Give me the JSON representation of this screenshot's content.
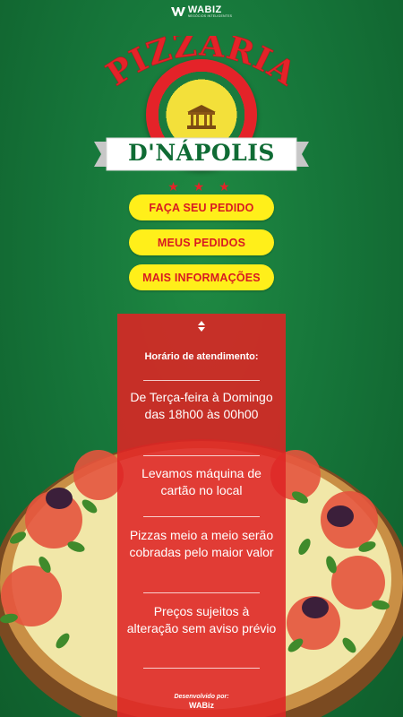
{
  "brand": {
    "name": "WABIZ",
    "tagline": "NEGÓCIOS INTELIGENTES",
    "icon": "wabiz-logo-icon"
  },
  "logo": {
    "title": "PIZZARIA",
    "name": "D'NÁPOLIS",
    "emblem_icon": "temple-icon",
    "stars": "★ ★ ★"
  },
  "menu": {
    "order_label": "FAÇA SEU PEDIDO",
    "my_orders_label": "MEUS PEDIDOS",
    "more_info_label": "MAIS INFORMAÇÕES"
  },
  "info": {
    "toggle_icon": "up-down-arrows-icon",
    "hours_title": "Horário de atendimento:",
    "hours_text": "De Terça-feira à Domingo das 18h00 às 00h00",
    "card_text": "Levamos máquina de cartão no local",
    "half_text": "Pizzas meio a meio serão cobradas pelo maior valor",
    "prices_text": "Preços sujeitos à alteração sem aviso prévio"
  },
  "footer": {
    "developed_by": "Desenvolvido por:",
    "developer": "WABiz"
  },
  "colors": {
    "background": "#16763a",
    "button_bg": "#ffef1a",
    "button_text": "#d81a22",
    "panel_bg": "#de2424"
  }
}
